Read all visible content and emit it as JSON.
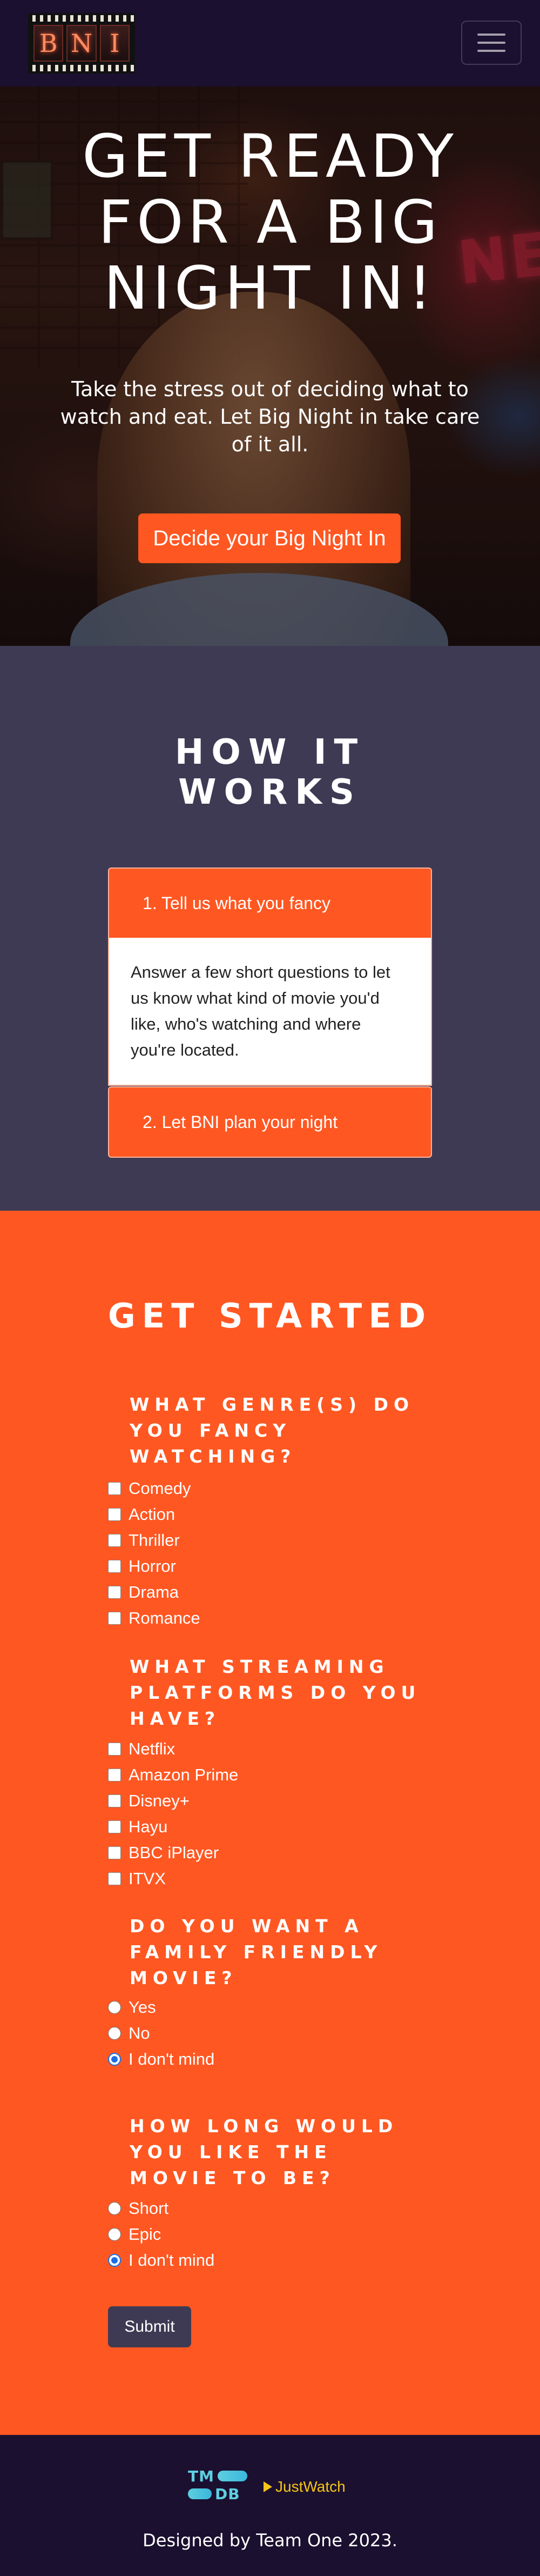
{
  "navbar": {
    "logo_letters": [
      "B",
      "N",
      "I"
    ],
    "menu_toggle": "hamburger-icon"
  },
  "hero": {
    "title": "Get ready for a Big Night In!",
    "subtitle": "Take the stress out of deciding what to watch and eat. Let Big Night in take care of it all.",
    "cta_label": "Decide your Big Night In"
  },
  "how_it_works": {
    "title": "How it works",
    "steps": [
      {
        "label": "1. Tell us what you fancy",
        "body": "Answer a few short questions to let us know what kind of movie you'd like, who's watching and where you're located."
      },
      {
        "label": "2. Let BNI plan your night",
        "body": ""
      }
    ]
  },
  "get_started": {
    "title": "Get started",
    "genre": {
      "question": "What genre(s) do you fancy watching?",
      "options": [
        "Comedy",
        "Action",
        "Thriller",
        "Horror",
        "Drama",
        "Romance"
      ]
    },
    "platforms": {
      "question": "What streaming platforms do you have?",
      "options": [
        "Netflix",
        "Amazon Prime",
        "Disney+",
        "Hayu",
        "BBC iPlayer",
        "ITVX"
      ]
    },
    "family": {
      "question": "Do you want a family friendly movie?",
      "options": [
        "Yes",
        "No",
        "I don't mind"
      ],
      "selected": "I don't mind"
    },
    "length": {
      "question": "How long would you like the movie to be?",
      "options": [
        "Short",
        "Epic",
        "I don't mind"
      ],
      "selected": "I don't mind"
    },
    "submit_label": "Submit"
  },
  "footer": {
    "tmdb_logo_text": [
      "TM",
      "DB"
    ],
    "justwatch_label": "JustWatch",
    "credit": "Designed by Team One 2023."
  },
  "colors": {
    "accent": "#ff5722",
    "navy": "#1b1030",
    "slate": "#3e3a54",
    "radio_checked": "#1a6ee8"
  }
}
